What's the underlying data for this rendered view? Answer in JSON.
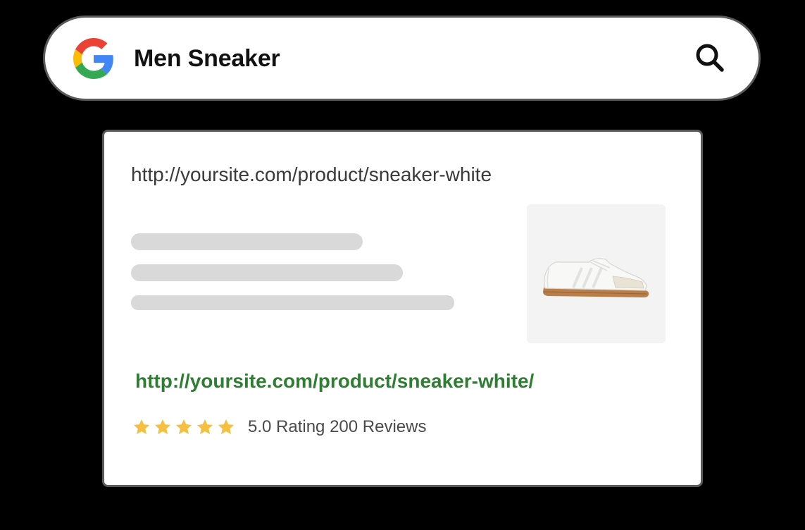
{
  "search": {
    "query": "Men Sneaker",
    "logo_icon": "google-g-icon",
    "button_icon": "search-icon"
  },
  "result": {
    "display_url": "http://yoursite.com/product/sneaker-white",
    "link_url": "http://yoursite.com/product/sneaker-white/",
    "thumbnail_icon": "white-sneaker-image",
    "rating": {
      "stars": 5,
      "max_stars": 5,
      "text": "5.0 Rating 200 Reviews"
    }
  },
  "colors": {
    "background": "#000000",
    "link_green": "#2f7d33",
    "star_gold": "#f5bf42",
    "placeholder_gray": "#d9d9d9",
    "google_blue": "#4285F4",
    "google_red": "#EA4335",
    "google_yellow": "#FBBC05",
    "google_green": "#34A853"
  }
}
